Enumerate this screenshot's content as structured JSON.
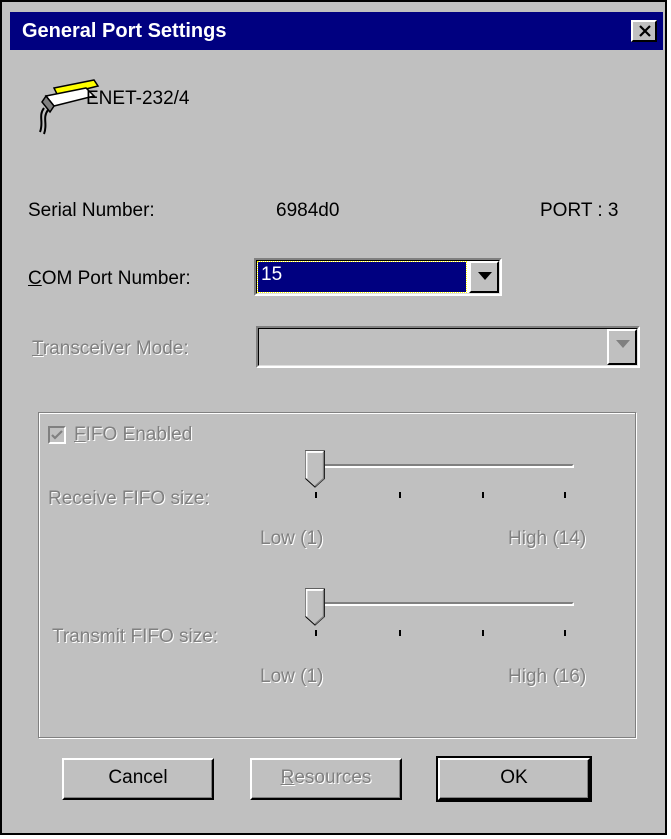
{
  "window": {
    "title": "General Port Settings"
  },
  "device": {
    "name": "ENET-232/4",
    "icon": "serial-cable-icon"
  },
  "info": {
    "serial_label": "Serial Number:",
    "serial_value": "6984d0",
    "port_label": "PORT : 3"
  },
  "com_port": {
    "label": "COM Port Number:",
    "value": "15"
  },
  "transceiver": {
    "label": "Transceiver Mode:",
    "value": ""
  },
  "fifo": {
    "checkbox_label": "FIFO Enabled",
    "checked": true,
    "receive": {
      "label": "Receive FIFO size:",
      "low_label": "Low (1)",
      "high_label": "High (14)",
      "value": 1
    },
    "transmit": {
      "label": "Transmit FIFO size:",
      "low_label": "Low (1)",
      "high_label": "High (16)",
      "value": 1
    }
  },
  "buttons": {
    "cancel": "Cancel",
    "resources": "Resources",
    "ok": "OK"
  },
  "colors": {
    "titlebar": "#000080",
    "face": "#c0c0c0",
    "disabled_text": "#808080"
  }
}
